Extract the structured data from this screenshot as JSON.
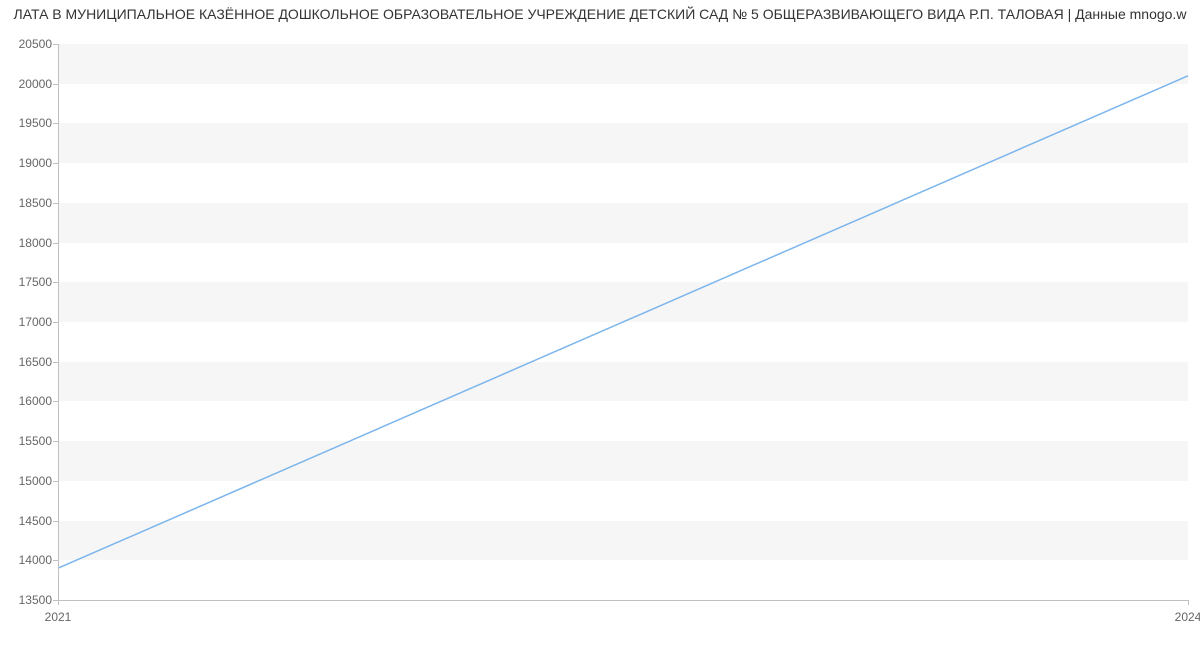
{
  "chart_data": {
    "type": "line",
    "title": "ЛАТА В МУНИЦИПАЛЬНОЕ КАЗЁННОЕ ДОШКОЛЬНОЕ ОБРАЗОВАТЕЛЬНОЕ УЧРЕЖДЕНИЕ ДЕТСКИЙ САД № 5 ОБЩЕРАЗВИВАЮЩЕГО ВИДА Р.П. ТАЛОВАЯ | Данные mnogo.w",
    "x": [
      2021,
      2024
    ],
    "values": [
      13900,
      20100
    ],
    "xlabel": "",
    "ylabel": "",
    "xlim": [
      2021,
      2024
    ],
    "ylim": [
      13500,
      20500
    ],
    "x_ticks": [
      2021,
      2024
    ],
    "y_ticks": [
      13500,
      14000,
      14500,
      15000,
      15500,
      16000,
      16500,
      17000,
      17500,
      18000,
      18500,
      19000,
      19500,
      20000,
      20500
    ],
    "line_color": "#7cb5ec",
    "grid_band_color": "#f6f6f6"
  }
}
